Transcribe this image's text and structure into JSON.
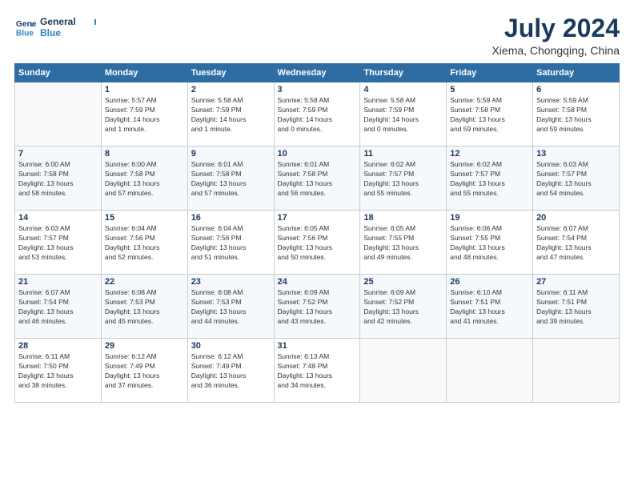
{
  "logo": {
    "line1": "General",
    "line2": "Blue"
  },
  "title": "July 2024",
  "location": "Xiema, Chongqing, China",
  "days_header": [
    "Sunday",
    "Monday",
    "Tuesday",
    "Wednesday",
    "Thursday",
    "Friday",
    "Saturday"
  ],
  "weeks": [
    [
      {
        "day": "",
        "info": ""
      },
      {
        "day": "1",
        "info": "Sunrise: 5:57 AM\nSunset: 7:59 PM\nDaylight: 14 hours\nand 1 minute."
      },
      {
        "day": "2",
        "info": "Sunrise: 5:58 AM\nSunset: 7:59 PM\nDaylight: 14 hours\nand 1 minute."
      },
      {
        "day": "3",
        "info": "Sunrise: 5:58 AM\nSunset: 7:59 PM\nDaylight: 14 hours\nand 0 minutes."
      },
      {
        "day": "4",
        "info": "Sunrise: 5:58 AM\nSunset: 7:59 PM\nDaylight: 14 hours\nand 0 minutes."
      },
      {
        "day": "5",
        "info": "Sunrise: 5:59 AM\nSunset: 7:58 PM\nDaylight: 13 hours\nand 59 minutes."
      },
      {
        "day": "6",
        "info": "Sunrise: 5:59 AM\nSunset: 7:58 PM\nDaylight: 13 hours\nand 59 minutes."
      }
    ],
    [
      {
        "day": "7",
        "info": "Sunrise: 6:00 AM\nSunset: 7:58 PM\nDaylight: 13 hours\nand 58 minutes."
      },
      {
        "day": "8",
        "info": "Sunrise: 6:00 AM\nSunset: 7:58 PM\nDaylight: 13 hours\nand 57 minutes."
      },
      {
        "day": "9",
        "info": "Sunrise: 6:01 AM\nSunset: 7:58 PM\nDaylight: 13 hours\nand 57 minutes."
      },
      {
        "day": "10",
        "info": "Sunrise: 6:01 AM\nSunset: 7:58 PM\nDaylight: 13 hours\nand 56 minutes."
      },
      {
        "day": "11",
        "info": "Sunrise: 6:02 AM\nSunset: 7:57 PM\nDaylight: 13 hours\nand 55 minutes."
      },
      {
        "day": "12",
        "info": "Sunrise: 6:02 AM\nSunset: 7:57 PM\nDaylight: 13 hours\nand 55 minutes."
      },
      {
        "day": "13",
        "info": "Sunrise: 6:03 AM\nSunset: 7:57 PM\nDaylight: 13 hours\nand 54 minutes."
      }
    ],
    [
      {
        "day": "14",
        "info": "Sunrise: 6:03 AM\nSunset: 7:57 PM\nDaylight: 13 hours\nand 53 minutes."
      },
      {
        "day": "15",
        "info": "Sunrise: 6:04 AM\nSunset: 7:56 PM\nDaylight: 13 hours\nand 52 minutes."
      },
      {
        "day": "16",
        "info": "Sunrise: 6:04 AM\nSunset: 7:56 PM\nDaylight: 13 hours\nand 51 minutes."
      },
      {
        "day": "17",
        "info": "Sunrise: 6:05 AM\nSunset: 7:56 PM\nDaylight: 13 hours\nand 50 minutes."
      },
      {
        "day": "18",
        "info": "Sunrise: 6:05 AM\nSunset: 7:55 PM\nDaylight: 13 hours\nand 49 minutes."
      },
      {
        "day": "19",
        "info": "Sunrise: 6:06 AM\nSunset: 7:55 PM\nDaylight: 13 hours\nand 48 minutes."
      },
      {
        "day": "20",
        "info": "Sunrise: 6:07 AM\nSunset: 7:54 PM\nDaylight: 13 hours\nand 47 minutes."
      }
    ],
    [
      {
        "day": "21",
        "info": "Sunrise: 6:07 AM\nSunset: 7:54 PM\nDaylight: 13 hours\nand 46 minutes."
      },
      {
        "day": "22",
        "info": "Sunrise: 6:08 AM\nSunset: 7:53 PM\nDaylight: 13 hours\nand 45 minutes."
      },
      {
        "day": "23",
        "info": "Sunrise: 6:08 AM\nSunset: 7:53 PM\nDaylight: 13 hours\nand 44 minutes."
      },
      {
        "day": "24",
        "info": "Sunrise: 6:09 AM\nSunset: 7:52 PM\nDaylight: 13 hours\nand 43 minutes."
      },
      {
        "day": "25",
        "info": "Sunrise: 6:09 AM\nSunset: 7:52 PM\nDaylight: 13 hours\nand 42 minutes."
      },
      {
        "day": "26",
        "info": "Sunrise: 6:10 AM\nSunset: 7:51 PM\nDaylight: 13 hours\nand 41 minutes."
      },
      {
        "day": "27",
        "info": "Sunrise: 6:11 AM\nSunset: 7:51 PM\nDaylight: 13 hours\nand 39 minutes."
      }
    ],
    [
      {
        "day": "28",
        "info": "Sunrise: 6:11 AM\nSunset: 7:50 PM\nDaylight: 13 hours\nand 38 minutes."
      },
      {
        "day": "29",
        "info": "Sunrise: 6:12 AM\nSunset: 7:49 PM\nDaylight: 13 hours\nand 37 minutes."
      },
      {
        "day": "30",
        "info": "Sunrise: 6:12 AM\nSunset: 7:49 PM\nDaylight: 13 hours\nand 36 minutes."
      },
      {
        "day": "31",
        "info": "Sunrise: 6:13 AM\nSunset: 7:48 PM\nDaylight: 13 hours\nand 34 minutes."
      },
      {
        "day": "",
        "info": ""
      },
      {
        "day": "",
        "info": ""
      },
      {
        "day": "",
        "info": ""
      }
    ]
  ]
}
